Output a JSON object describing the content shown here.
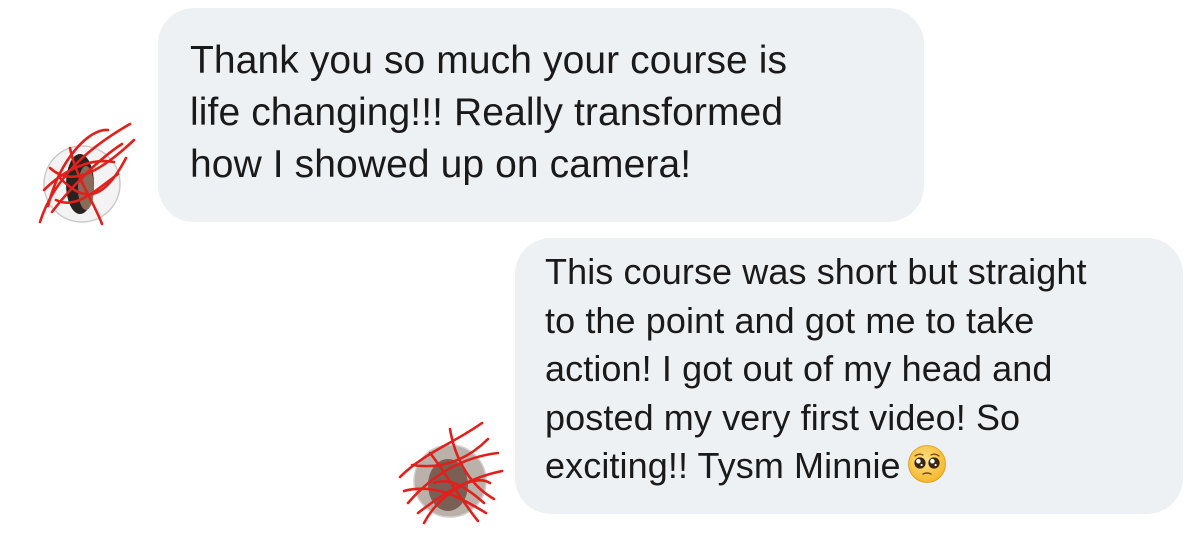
{
  "messages": [
    {
      "direction": "incoming",
      "lines": [
        "Thank you so much your course is",
        "life changing!!! Really transformed",
        "how I showed up on camera!"
      ],
      "avatar_icon": "redacted-avatar-icon"
    },
    {
      "direction": "incoming",
      "lines": [
        "This course was short but straight",
        "to the point and got me to take",
        "action! I got out of my head and",
        "posted my very first video! So",
        "exciting!! Tysm Minnie"
      ],
      "emoji": "pleading-face-emoji",
      "avatar_icon": "redacted-avatar-icon"
    }
  ],
  "colors": {
    "bubble_bg": "#eef1f4",
    "text": "#1a1a1a",
    "scribble": "#e0201b"
  }
}
